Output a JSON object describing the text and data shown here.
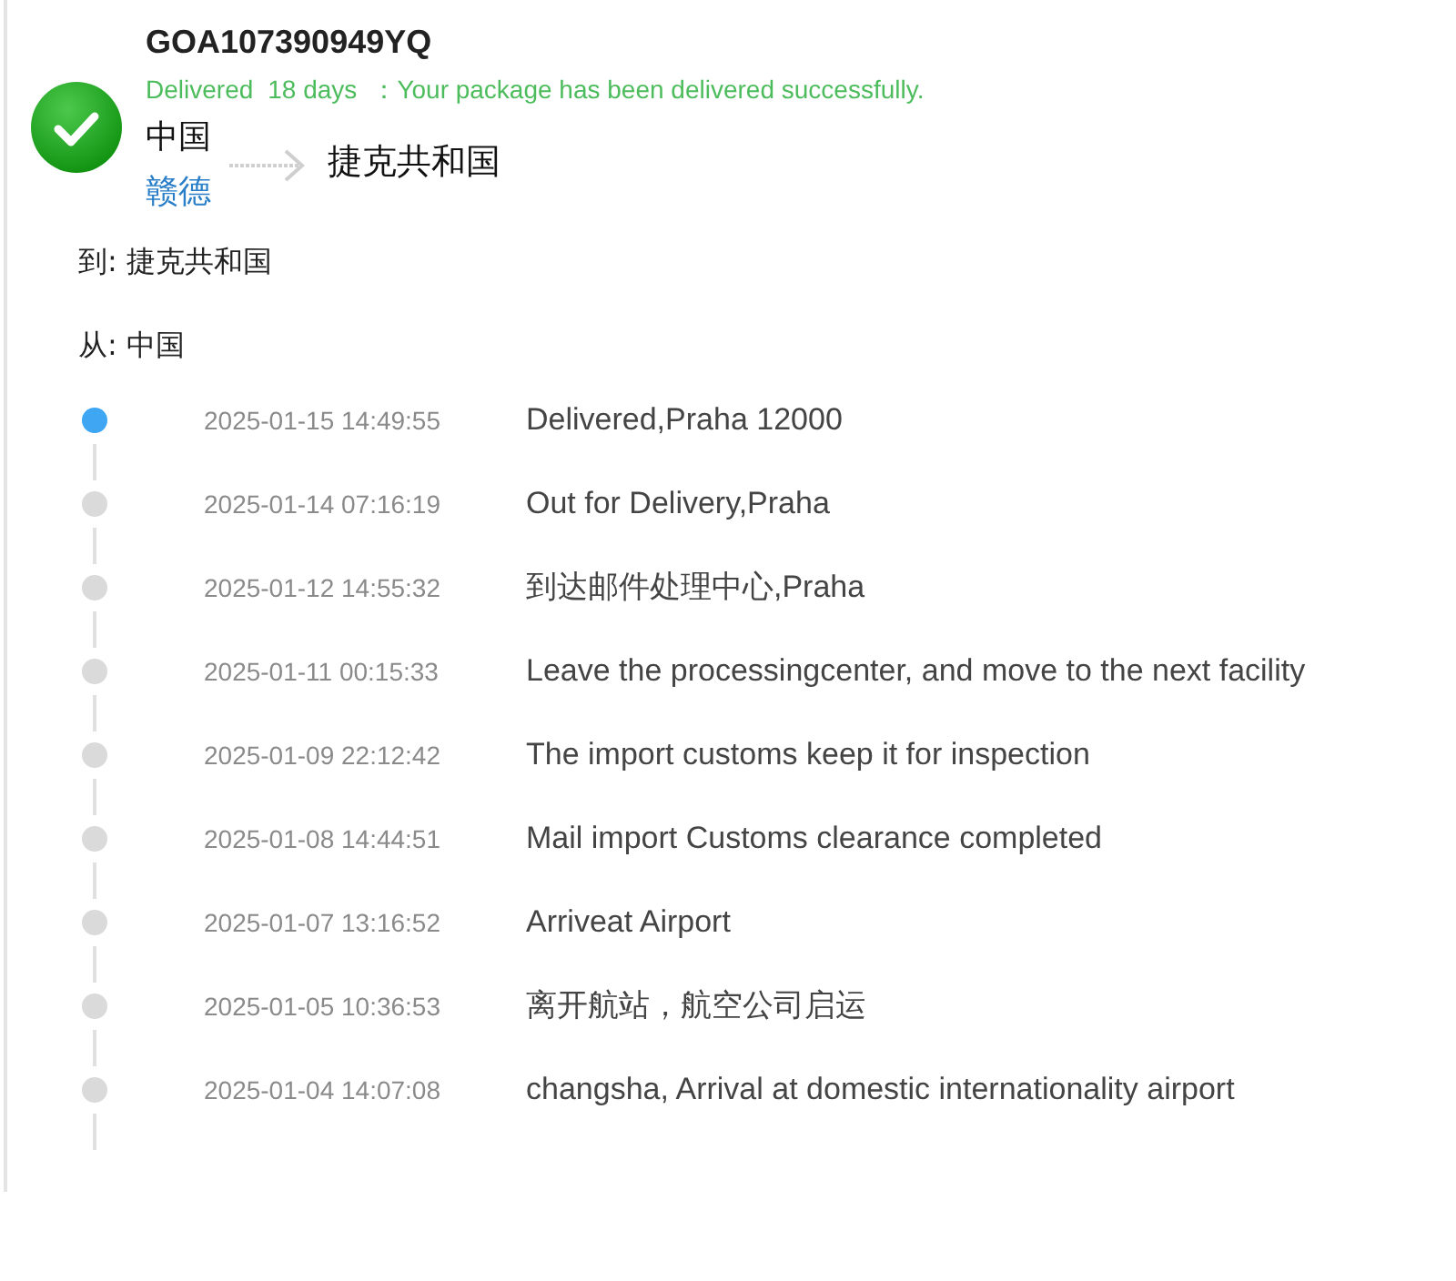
{
  "shipment": {
    "tracking_number": "GOA107390949YQ",
    "status": "Delivered",
    "duration": "18 days",
    "message": "：Your package has been delivered successfully.",
    "delivered": true,
    "origin": "中国",
    "origin_carrier": "赣德",
    "destination": "捷克共和国"
  },
  "to": "到: 捷克共和国",
  "from": "从: 中国",
  "events": [
    {
      "time": "2025-01-15 14:49:55",
      "description": "Delivered,Praha 12000",
      "current": true
    },
    {
      "time": "2025-01-14 07:16:19",
      "description": "Out for Delivery,Praha",
      "current": false
    },
    {
      "time": "2025-01-12 14:55:32",
      "description": "到达邮件处理中心,Praha",
      "current": false
    },
    {
      "time": "2025-01-11 00:15:33",
      "description": "Leave the processingcenter, and move to the next facility",
      "current": false
    },
    {
      "time": "2025-01-09 22:12:42",
      "description": "The import customs keep it for inspection",
      "current": false
    },
    {
      "time": "2025-01-08 14:44:51",
      "description": "Mail import Customs clearance completed",
      "current": false
    },
    {
      "time": "2025-01-07 13:16:52",
      "description": "Arriveat Airport",
      "current": false
    },
    {
      "time": "2025-01-05 10:36:53",
      "description": "离开航站，航空公司启运",
      "current": false
    },
    {
      "time": "2025-01-04 14:07:08",
      "description": "changsha, Arrival at domestic internationality airport",
      "current": false
    }
  ]
}
